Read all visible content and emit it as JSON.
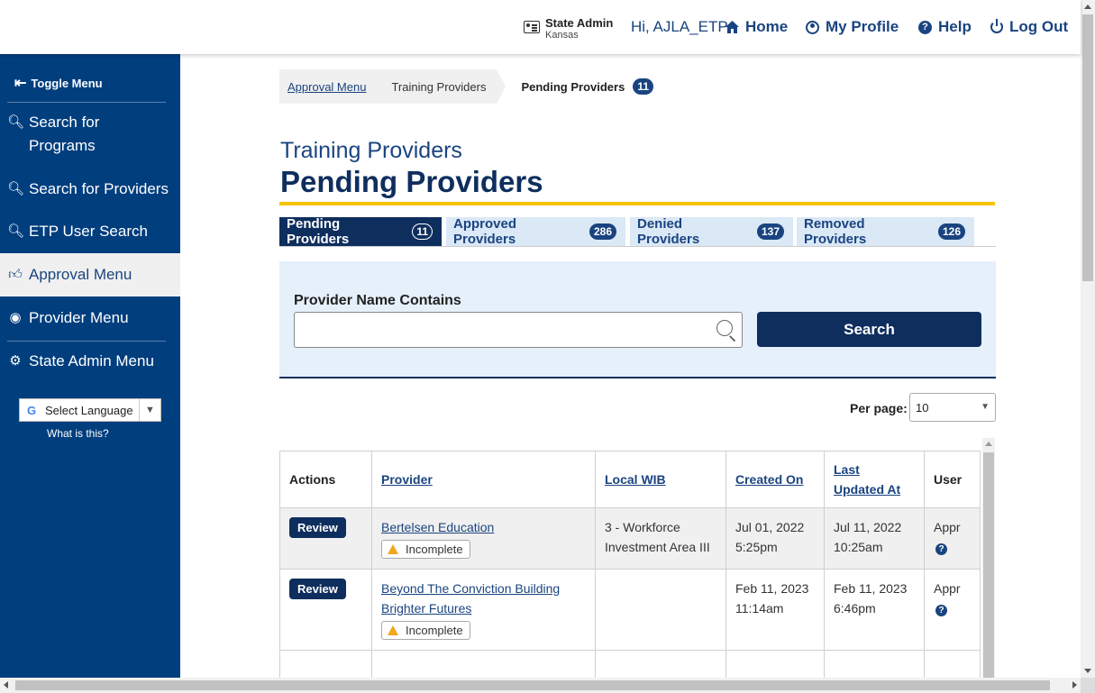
{
  "header": {
    "role_title": "State Admin",
    "role_sub": "Kansas",
    "greeting": "Hi, AJLA_ETP",
    "nav": {
      "home": "Home",
      "profile": "My Profile",
      "help": "Help",
      "logout": "Log Out"
    }
  },
  "sidebar": {
    "toggle_label": "Toggle Menu",
    "items": [
      {
        "label": "Search for Programs",
        "icon": "search-programs-icon"
      },
      {
        "label": "Search for Providers",
        "icon": "search-providers-icon"
      },
      {
        "label": "ETP User Search",
        "icon": "user-search-icon"
      },
      {
        "label": "Approval Menu",
        "icon": "thumbs-up-icon"
      },
      {
        "label": "Provider Menu",
        "icon": "provider-icon"
      },
      {
        "label": "State Admin Menu",
        "icon": "gear-icon"
      }
    ],
    "language_label": "Select Language",
    "what_is_this": "What is this?"
  },
  "breadcrumb": {
    "first": "Approval Menu",
    "second": "Training Providers",
    "current": "Pending Providers",
    "current_count": "11"
  },
  "page": {
    "subtitle": "Training Providers",
    "title": "Pending Providers"
  },
  "tabs": [
    {
      "label": "Pending Providers",
      "count": "11"
    },
    {
      "label": "Approved Providers",
      "count": "286"
    },
    {
      "label": "Denied Providers",
      "count": "137"
    },
    {
      "label": "Removed Providers",
      "count": "126"
    }
  ],
  "search": {
    "label": "Provider Name Contains",
    "value": "",
    "button": "Search"
  },
  "per_page": {
    "label": "Per page:",
    "value": "10"
  },
  "table": {
    "headers": {
      "actions": "Actions",
      "provider": "Provider",
      "local_wib": "Local WIB",
      "created_on": "Created On",
      "last_updated_line1": "Last",
      "last_updated_line2": "Updated At",
      "user": "User"
    },
    "rows": [
      {
        "action": "Review",
        "provider": "Bertelsen Education",
        "status": "Incomplete",
        "local_wib": "3 - Workforce Investment Area III",
        "created_date": "Jul 01, 2022",
        "created_time": "5:25pm",
        "updated_date": "Jul 11, 2022",
        "updated_time": "10:25am",
        "user": "Appr"
      },
      {
        "action": "Review",
        "provider": "Beyond The Conviction Building Brighter Futures",
        "status": "Incomplete",
        "local_wib": "",
        "created_date": "Feb 11, 2023",
        "created_time": "11:14am",
        "updated_date": "Feb 11, 2023",
        "updated_time": "6:46pm",
        "user": "Appr"
      }
    ]
  },
  "colors": {
    "navy": "#0e2e5e",
    "sidebar_blue": "#003e7e",
    "link_blue": "#1a4480",
    "accent_yellow": "#f5c400",
    "panel_bg": "#e6f0fb",
    "warning": "#f0a81c"
  }
}
